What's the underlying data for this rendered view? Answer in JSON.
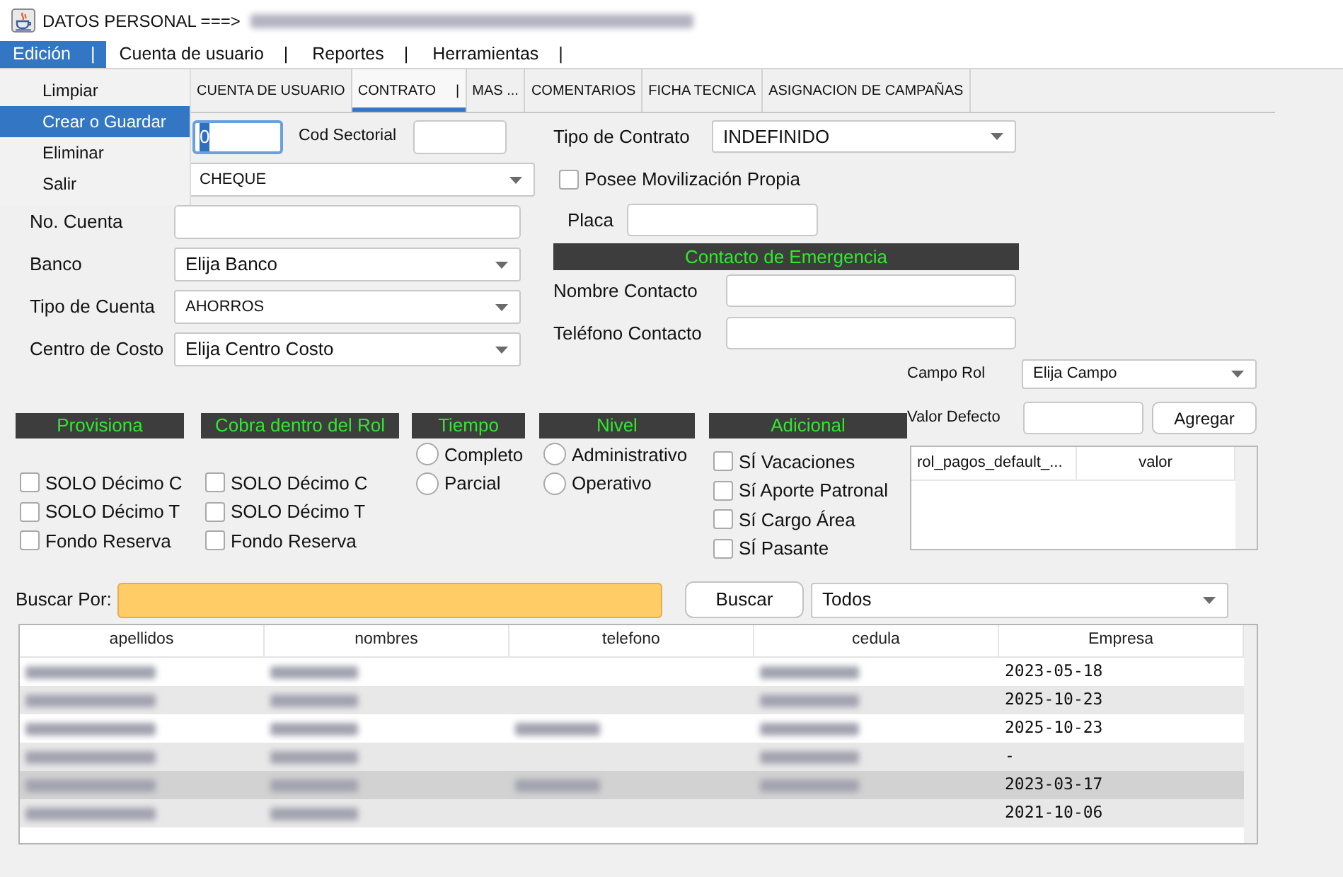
{
  "window": {
    "title": "DATOS PERSONAL ===>",
    "title_redacted": true
  },
  "menu_bar": [
    {
      "label": "Edición",
      "suffix": "|",
      "selected": true
    },
    {
      "label": "Cuenta de usuario",
      "suffix": "|",
      "selected": false
    },
    {
      "label": "Reportes",
      "suffix": "|",
      "selected": false
    },
    {
      "label": "Herramientas",
      "suffix": "|",
      "selected": false
    }
  ],
  "open_menu": {
    "items": [
      {
        "label": "Limpiar",
        "selected": false
      },
      {
        "label": "Crear o Guardar",
        "selected": true
      },
      {
        "label": "Eliminar",
        "selected": false
      },
      {
        "label": "Salir",
        "selected": false
      }
    ]
  },
  "tabs": [
    {
      "label": "CUENTA DE USUARIO",
      "selected": false
    },
    {
      "label": "CONTRATO",
      "suffix": "|",
      "selected": true
    },
    {
      "label": "MAS ...",
      "selected": false
    },
    {
      "label": "COMENTARIOS",
      "selected": false
    },
    {
      "label": "FICHA TECNICA",
      "selected": false
    },
    {
      "label": "ASIGNACION DE CAMPAÑAS",
      "selected": false
    }
  ],
  "left_fields": [
    {
      "kind": "input",
      "value": "0",
      "focused": true
    },
    {
      "kind": "select",
      "value": "CHEQUE",
      "focused": false
    },
    {
      "kind": "input",
      "label": "No. Cuenta",
      "focused": false
    },
    {
      "kind": "select",
      "label": "Banco",
      "value": "Elija Banco",
      "focused": false
    },
    {
      "kind": "select",
      "label": "Tipo de Cuenta",
      "value": "AHORROS",
      "focused": false
    },
    {
      "kind": "select",
      "label": "Centro de Costo",
      "value": "Elija Centro Costo",
      "focused": false
    }
  ],
  "cod_sectorial": {
    "label": "Cod Sectorial"
  },
  "contract": {
    "type": {
      "label": "Tipo de Contrato",
      "value": "INDEFINIDO"
    },
    "own_vehicle": {
      "label": "Posee Movilización Propia",
      "checked": false
    },
    "plate": {
      "label": "Placa"
    }
  },
  "emergency_contact": {
    "title": "Contacto de Emergencia",
    "fields": [
      {
        "label": "Nombre Contacto"
      },
      {
        "label": "Teléfono Contacto"
      }
    ]
  },
  "role_defaults": {
    "field": {
      "label": "Campo Rol",
      "value": "Elija Campo"
    },
    "default_value": {
      "label": "Valor Defecto"
    },
    "add_button": {
      "label": "Agregar"
    },
    "columns": [
      "rol_pagos_default_...",
      "valor"
    ]
  },
  "sections": [
    {
      "title": "Provisiona",
      "kind": "checkbox",
      "items": [
        {
          "label": "SOLO Décimo C",
          "checked": false
        },
        {
          "label": "SOLO Décimo T",
          "checked": false
        },
        {
          "label": "Fondo Reserva",
          "checked": false
        }
      ]
    },
    {
      "title": "Cobra dentro del Rol",
      "kind": "checkbox",
      "items": [
        {
          "label": "SOLO Décimo C",
          "checked": false
        },
        {
          "label": "SOLO Décimo T",
          "checked": false
        },
        {
          "label": "Fondo Reserva",
          "checked": false
        }
      ]
    },
    {
      "title": "Tiempo",
      "kind": "radio",
      "items": [
        {
          "label": "Completo",
          "selected": false
        },
        {
          "label": "Parcial",
          "selected": false
        }
      ]
    },
    {
      "title": "Nivel",
      "kind": "radio",
      "items": [
        {
          "label": "Administrativo",
          "selected": false
        },
        {
          "label": "Operativo",
          "selected": false
        }
      ]
    },
    {
      "title": "Adicional",
      "kind": "checkbox",
      "items": [
        {
          "label": "SÍ Vacaciones",
          "checked": false
        },
        {
          "label": "Sí Aporte Patronal",
          "checked": false
        },
        {
          "label": "Sí Cargo Área",
          "checked": false
        },
        {
          "label": "SÍ Pasante",
          "checked": false
        }
      ]
    }
  ],
  "search": {
    "label": "Buscar Por:",
    "button": {
      "label": "Buscar"
    },
    "filter": {
      "value": "Todos"
    }
  },
  "table": {
    "columns": [
      "apellidos",
      "nombres",
      "telefono",
      "cedula",
      "Empresa"
    ],
    "rows": [
      {
        "blurred": [
          true,
          true,
          false,
          true
        ],
        "empresa": "2023-05-18",
        "selected": false
      },
      {
        "blurred": [
          true,
          true,
          false,
          true
        ],
        "empresa": "2025-10-23",
        "selected": false
      },
      {
        "blurred": [
          true,
          true,
          true,
          true
        ],
        "empresa": "2025-10-23",
        "selected": false
      },
      {
        "blurred": [
          true,
          true,
          false,
          true
        ],
        "empresa": "-",
        "selected": false
      },
      {
        "blurred": [
          true,
          true,
          true,
          true
        ],
        "empresa": "2023-03-17",
        "selected": true
      },
      {
        "blurred": [
          true,
          true,
          false,
          false
        ],
        "empresa": "2021-10-06",
        "selected": false
      }
    ]
  }
}
